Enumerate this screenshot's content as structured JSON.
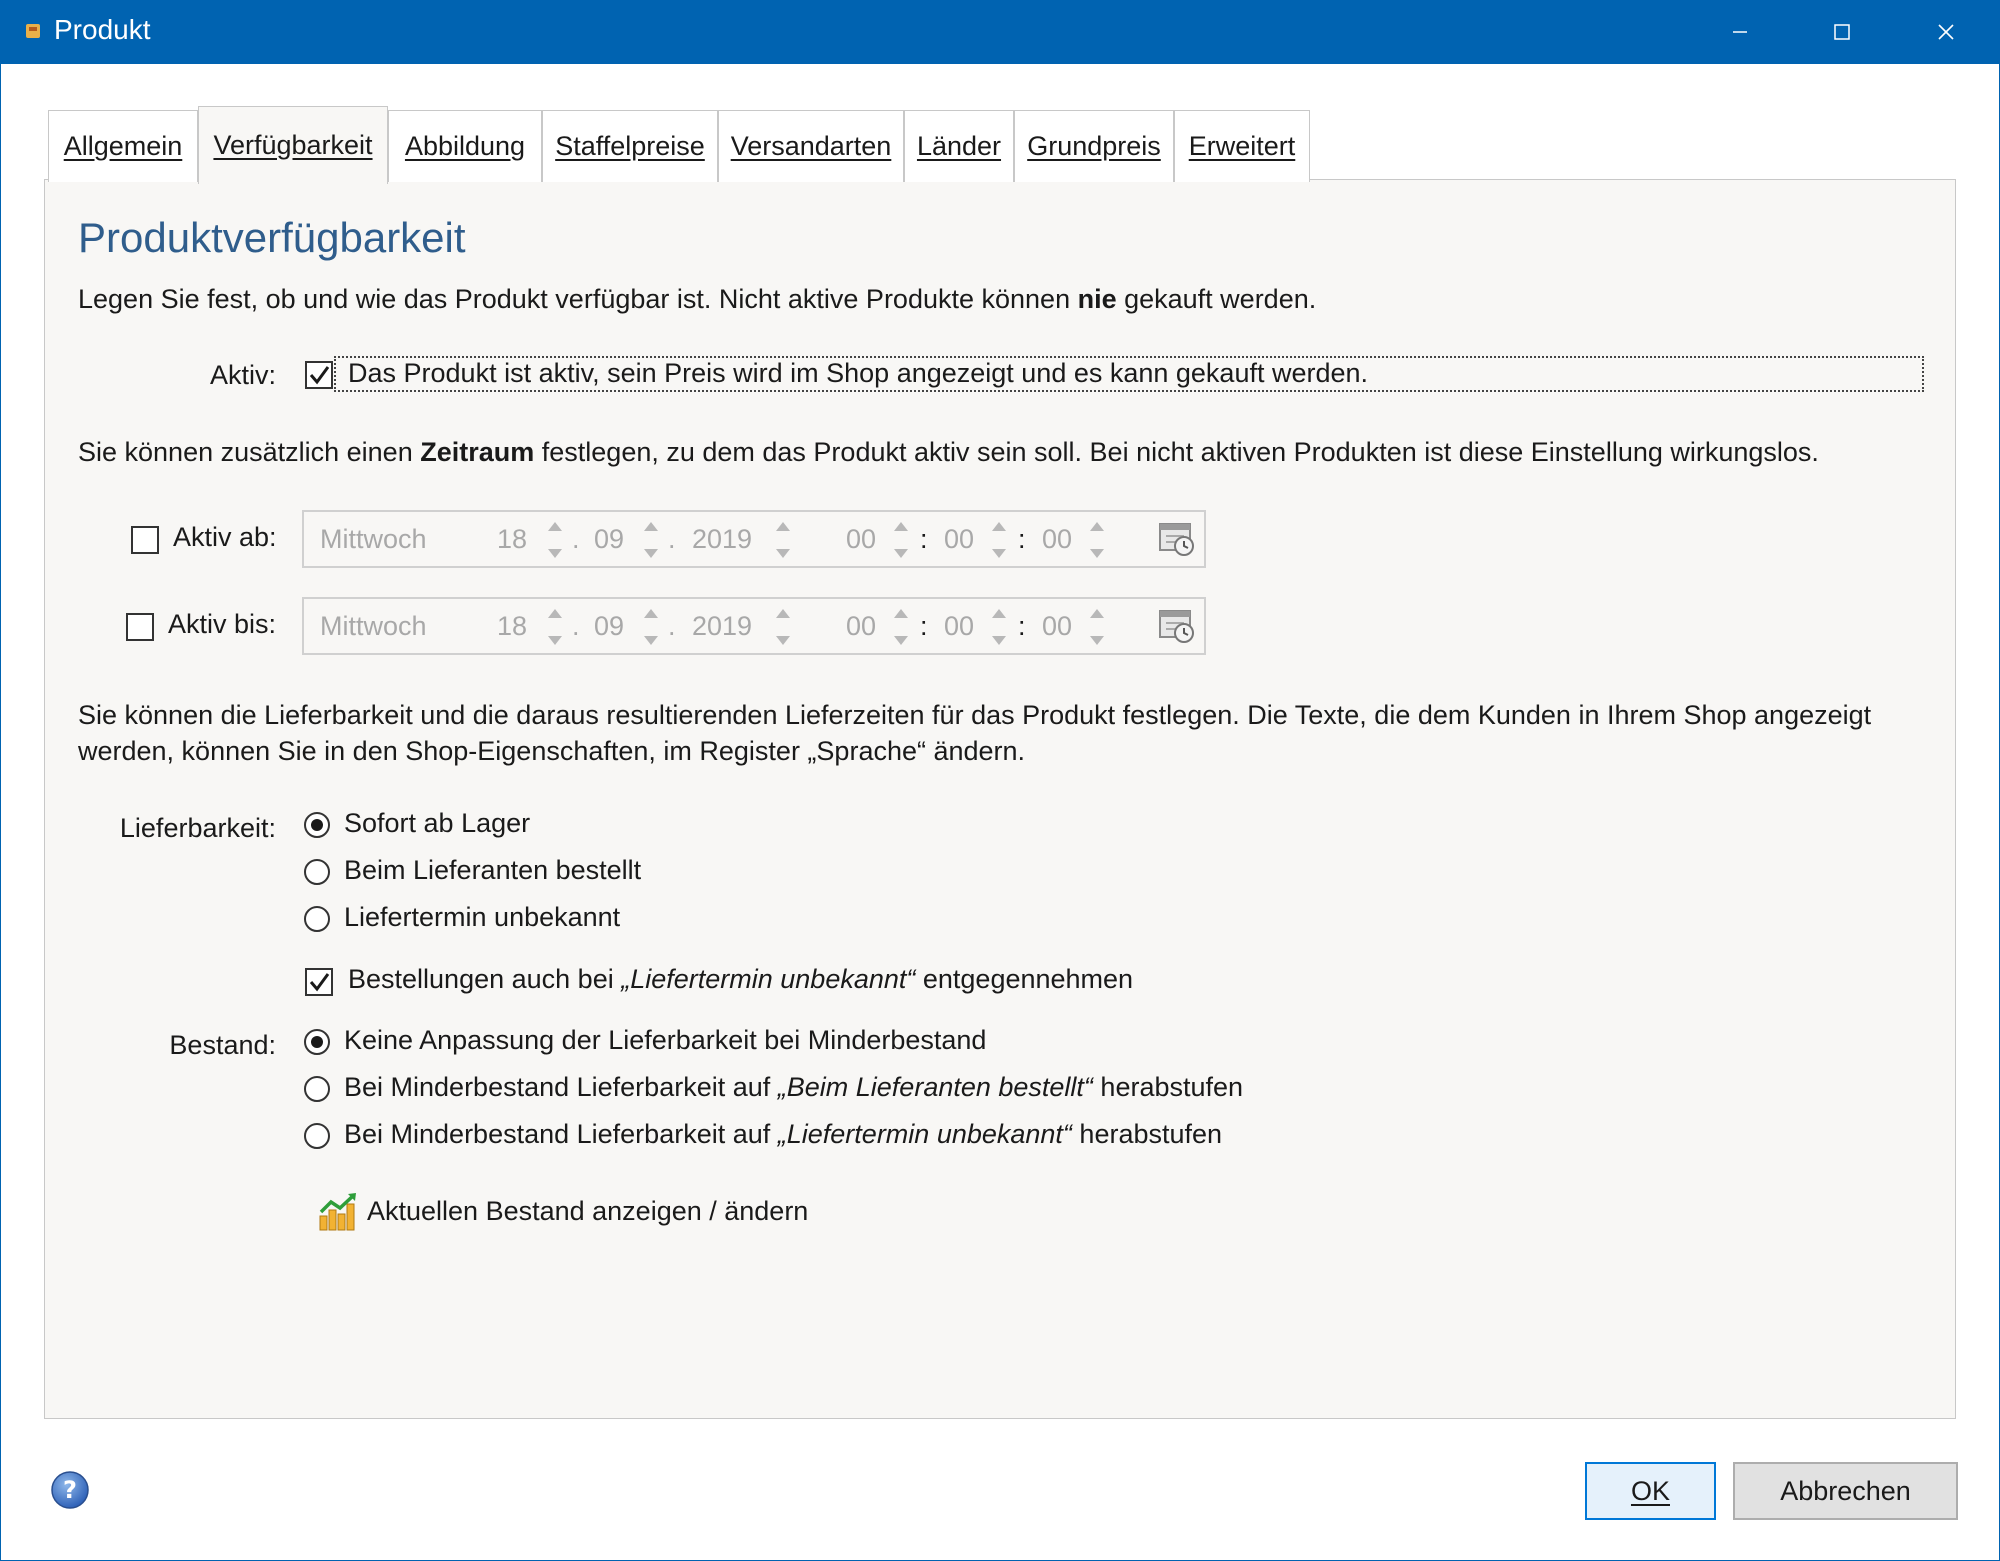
{
  "window": {
    "title": "Produkt"
  },
  "tabs": [
    {
      "label": "Allgemein",
      "active": false
    },
    {
      "label": "Verfügbarkeit",
      "active": true
    },
    {
      "label": "Abbildung",
      "active": false
    },
    {
      "label": "Staffelpreise",
      "active": false
    },
    {
      "label": "Versandarten",
      "active": false
    },
    {
      "label": "Länder",
      "active": false
    },
    {
      "label": "Grundpreis",
      "active": false
    },
    {
      "label": "Erweitert",
      "active": false
    }
  ],
  "section": {
    "title": "Produktverfügbarkeit",
    "intro_a": "Legen Sie fest, ob und wie das Produkt verfügbar ist. Nicht aktive Produkte können ",
    "intro_bold": "nie",
    "intro_b": " gekauft werden."
  },
  "active": {
    "label": "Aktiv:",
    "checked": true,
    "checkbox_text": "Das Produkt ist aktiv, sein Preis wird im Shop angezeigt und es kann gekauft werden."
  },
  "period": {
    "text_a": "Sie können zusätzlich einen ",
    "text_bold": "Zeitraum",
    "text_b": " festlegen, zu dem das Produkt aktiv sein soll. Bei nicht aktiven Produkten ist diese Einstellung wirkungslos."
  },
  "active_from": {
    "label": "Aktiv ab:",
    "checked": false,
    "weekday": "Mittwoch",
    "day": "18",
    "month": "09",
    "year": "2019",
    "hour": "00",
    "minute": "00",
    "second": "00"
  },
  "active_until": {
    "label": "Aktiv bis:",
    "checked": false,
    "weekday": "Mittwoch",
    "day": "18",
    "month": "09",
    "year": "2019",
    "hour": "00",
    "minute": "00",
    "second": "00"
  },
  "delivery_info": {
    "line1": "Sie können die Lieferbarkeit und die daraus resultierenden Lieferzeiten für das Produkt festlegen. Die Texte, die dem Kunden in Ihrem Shop angezeigt",
    "line2": "werden, können Sie in den Shop-Eigenschaften, im Register „Sprache“ ändern."
  },
  "availability": {
    "label": "Lieferbarkeit:",
    "options": [
      "Sofort ab Lager",
      "Beim Lieferanten bestellt",
      "Liefertermin unbekannt"
    ],
    "selected_index": 0,
    "accept_orders": {
      "checked": true,
      "text_a": "Bestellungen auch bei ",
      "text_italic": "„Liefertermin unbekannt“",
      "text_b": " entgegennehmen"
    }
  },
  "stock": {
    "label": "Bestand:",
    "option1": "Keine Anpassung der Lieferbarkeit bei Minderbestand",
    "option2_a": "Bei Minderbestand Lieferbarkeit auf ",
    "option2_italic": "„Beim Lieferanten bestellt“",
    "option2_b": " herabstufen",
    "option3_a": "Bei Minderbestand Lieferbarkeit auf ",
    "option3_italic": "„Liefertermin unbekannt“",
    "option3_b": " herabstufen",
    "selected_index": 0,
    "link_text": "Aktuellen Bestand anzeigen / ändern"
  },
  "buttons": {
    "ok": "OK",
    "cancel": "Abbrechen"
  },
  "colors": {
    "titlebar": "#0063b1",
    "heading": "#2f5d8c",
    "panel": "#f8f7f5"
  }
}
